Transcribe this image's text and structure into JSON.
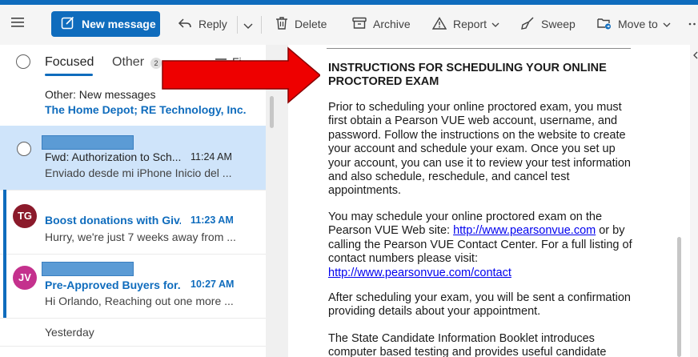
{
  "toolbar": {
    "new_message": "New message",
    "reply": "Reply",
    "delete": "Delete",
    "archive": "Archive",
    "report": "Report",
    "sweep": "Sweep",
    "move_to": "Move to"
  },
  "tabs": {
    "focused": "Focused",
    "other": "Other",
    "other_count": "2",
    "filter": "Fi"
  },
  "other_notice": {
    "title": "Other: New messages",
    "senders": "The Home Depot; RE Technology, Inc."
  },
  "messages": [
    {
      "subject": "Fwd: Authorization to Sch...",
      "time": "11:24 AM",
      "preview": "Enviado desde mi iPhone Inicio del ...",
      "selected": true,
      "unread": false
    },
    {
      "avatar": "TG",
      "avatar_color": "#8b1a2b",
      "subject": "Boost donations with Giv...",
      "time": "11:23 AM",
      "preview": "Hurry, we're just 7 weeks away from ...",
      "selected": false,
      "unread": true
    },
    {
      "avatar": "JV",
      "avatar_color": "#c4318d",
      "subject": "Pre-Approved Buyers for...",
      "time": "10:27 AM",
      "preview": "Hi Orlando, Reaching out one more ...",
      "selected": false,
      "unread": true
    }
  ],
  "date_group": "Yesterday",
  "reading": {
    "heading": "INSTRUCTIONS FOR SCHEDULING YOUR ONLINE PROCTORED EXAM",
    "para1": "Prior to scheduling your online proctored exam, you must first obtain a Pearson VUE web account, username, and password. Follow the instructions on the website to create your account and schedule your exam. Once you set up your account, you can use it to review your test information and also schedule, reschedule, and cancel test appointments.",
    "para2_a": "You may schedule your online proctored exam on the Pearson VUE Web site: ",
    "para2_link1": "http://www.pearsonvue.com",
    "para2_b": " or by calling the Pearson VUE Contact Center. For a full listing of contact numbers please visit: ",
    "para2_link2": "http://www.pearsonvue.com/contact",
    "para3": "After scheduling your exam, you will be sent a confirmation providing details about your appointment.",
    "para4": "The State Candidate Information Booklet introduces computer based testing and provides useful candidate"
  },
  "colors": {
    "accent": "#0f6cbd",
    "selected_bg": "#cfe4fa",
    "annotation_arrow": "#ee0000"
  }
}
